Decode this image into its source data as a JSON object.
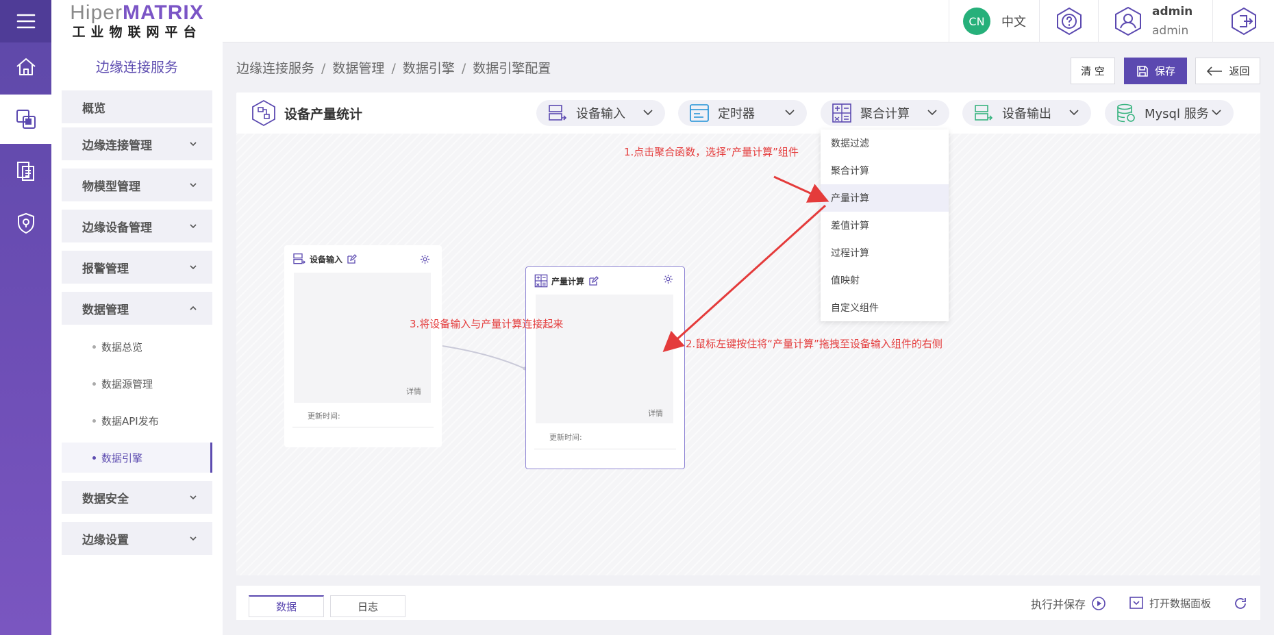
{
  "logo": {
    "brand_a": "Hiper",
    "brand_b": "MATRIX",
    "subtitle": "工业物联网平台"
  },
  "topbar": {
    "lang_badge": "CN",
    "lang_label": "中文",
    "user_name": "admin",
    "user_role": "admin"
  },
  "sidebar": {
    "title": "边缘连接服务",
    "items": [
      {
        "label": "概览"
      },
      {
        "label": "边缘连接管理"
      },
      {
        "label": "物模型管理"
      },
      {
        "label": "边缘设备管理"
      },
      {
        "label": "报警管理"
      },
      {
        "label": "数据管理"
      },
      {
        "label": "数据安全"
      },
      {
        "label": "边缘设置"
      }
    ],
    "sub_items": [
      {
        "label": "数据总览"
      },
      {
        "label": "数据源管理"
      },
      {
        "label": "数据API发布"
      },
      {
        "label": "数据引擎"
      }
    ]
  },
  "breadcrumb": {
    "b1": "边缘连接服务",
    "b2": "数据管理",
    "b3": "数据引擎",
    "b4": "数据引擎配置",
    "sep": "/"
  },
  "actions": {
    "clear": "清 空",
    "save": "保存",
    "back": "返回"
  },
  "toolbar": {
    "title": "设备产量统计",
    "pills": [
      {
        "label": "设备输入"
      },
      {
        "label": "定时器"
      },
      {
        "label": "聚合计算"
      },
      {
        "label": "设备输出"
      },
      {
        "label": "Mysql 服务"
      }
    ]
  },
  "dropdown": {
    "items": [
      "数据过滤",
      "聚合计算",
      "产量计算",
      "差值计算",
      "过程计算",
      "值映射",
      "自定义组件"
    ]
  },
  "nodes": {
    "input": {
      "title": "设备输入",
      "detail": "详情",
      "time": "更新时间:"
    },
    "calc": {
      "title": "产量计算",
      "detail": "详情",
      "time": "更新时间:"
    }
  },
  "annotations": {
    "a1": "1.点击聚合函数，选择“产量计算”组件",
    "a2": "2.鼠标左键按住将“产量计算”拖拽至设备输入组件的右侧",
    "a3": "3.将设备输入与产量计算连接起来"
  },
  "bottom": {
    "tab_data": "数据",
    "tab_log": "日志",
    "exec_save": "执行并保存",
    "open_panel": "打开数据面板"
  },
  "colors": {
    "accent": "#5b49b0",
    "rail": "#6a4fb5",
    "annotation": "#e43b3b",
    "lang_badge": "#26b07a"
  }
}
